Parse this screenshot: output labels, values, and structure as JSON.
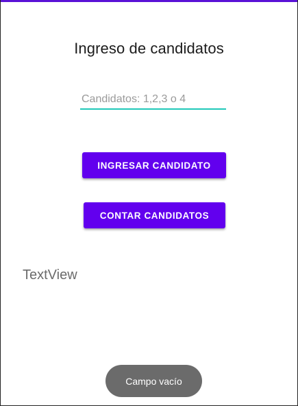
{
  "app": {
    "title": "Ingreso de candidatos"
  },
  "form": {
    "candidate_input": {
      "placeholder": "Candidatos: 1,2,3 o 4",
      "value": ""
    },
    "buttons": {
      "ingresar_label": "INGRESAR CANDIDATO",
      "contar_label": "CONTAR CANDIDATOS"
    }
  },
  "output": {
    "textview": "TextView"
  },
  "toast": {
    "message": "Campo vacío"
  },
  "colors": {
    "accent": "#6200ee",
    "input_underline": "#1fc8b8",
    "status_strip": "#5a12d6",
    "toast_bg": "#6b6b6b"
  }
}
